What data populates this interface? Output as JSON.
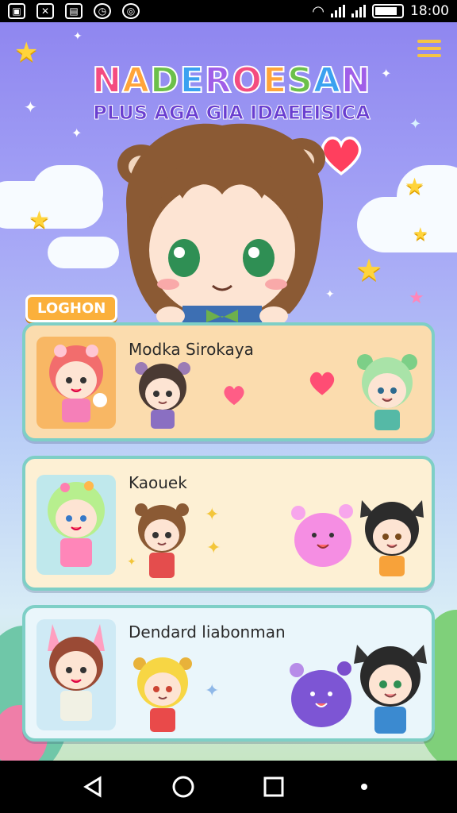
{
  "status_bar": {
    "time": "18:00",
    "left_icons": [
      "image-icon",
      "app-icon",
      "image-icon",
      "clock-icon",
      "app-icon"
    ],
    "battery_level": 0.85
  },
  "header": {
    "logo_title": "NADEROESAN",
    "logo_subtitle": "PLUS AGA GIA IDAEEISICA"
  },
  "section": {
    "label": "LOGHON"
  },
  "cards": [
    {
      "title": "Modka Sirokaya",
      "bg": "#fbdcae",
      "thumb_bg": "#f8b764"
    },
    {
      "title": "Kaouek",
      "bg": "#fdf0d4",
      "thumb_bg": "#bfe8ec"
    },
    {
      "title": "Dendard liabonman",
      "bg": "#eaf6fb",
      "thumb_bg": "#cfeaf5"
    }
  ],
  "nav": {
    "back": "back-icon",
    "home": "home-icon",
    "recents": "recents-icon",
    "dot": "dot-icon"
  },
  "colors": {
    "accent": "#fbb03b",
    "card_border": "#7ecfc6",
    "heart": "#ff4d74"
  }
}
